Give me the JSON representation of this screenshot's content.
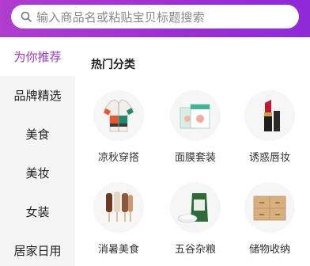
{
  "search": {
    "placeholder": "输入商品名或粘贴宝贝标题搜索"
  },
  "sidebar": {
    "items": [
      {
        "label": "为你推荐",
        "active": true
      },
      {
        "label": "品牌精选",
        "active": false
      },
      {
        "label": "美食",
        "active": false
      },
      {
        "label": "美妆",
        "active": false
      },
      {
        "label": "女装",
        "active": false
      },
      {
        "label": "居家日用",
        "active": false
      }
    ]
  },
  "main": {
    "section_title": "热门分类",
    "categories": [
      {
        "label": "凉秋穿搭",
        "icon": "jacket-icon"
      },
      {
        "label": "面膜套装",
        "icon": "facemask-box-icon"
      },
      {
        "label": "诱惑唇妆",
        "icon": "lipstick-icon"
      },
      {
        "label": "消暑美食",
        "icon": "popsicle-icon"
      },
      {
        "label": "五谷杂粮",
        "icon": "rice-bag-icon"
      },
      {
        "label": "储物收纳",
        "icon": "drawer-cabinet-icon"
      }
    ]
  },
  "colors": {
    "accent": "#a334d6",
    "topbar": "#9b2fd6",
    "sidebar_bg": "#f5f5f5"
  }
}
